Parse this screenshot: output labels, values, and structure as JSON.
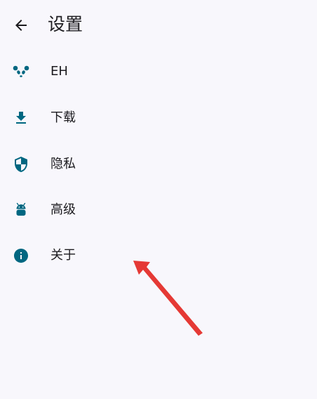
{
  "header": {
    "back_icon": "arrow-back-icon",
    "title": "设置"
  },
  "menu": {
    "items": [
      {
        "icon": "panda-icon",
        "label": "EH"
      },
      {
        "icon": "download-icon",
        "label": "下载"
      },
      {
        "icon": "shield-icon",
        "label": "隐私"
      },
      {
        "icon": "android-icon",
        "label": "高级"
      },
      {
        "icon": "info-icon",
        "label": "关于"
      }
    ]
  },
  "colors": {
    "icon_accent": "#006781",
    "text": "#1c1b1f",
    "background": "#f8f7fc",
    "annotation_arrow": "#e53935"
  }
}
